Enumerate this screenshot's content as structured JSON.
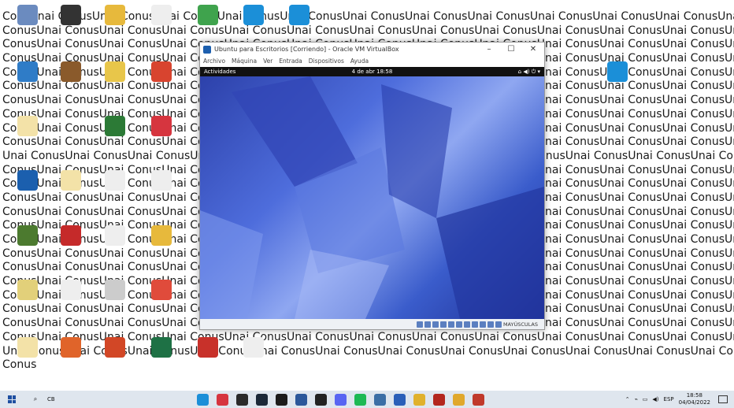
{
  "wallpaper": {
    "lines": [
      "ConsUnai ConusUnai ConusUnai ConusUnai ConusUnai ConusUnai ConusUnai ConusUnai ConusUnai ConusUnai ConusUnai ConusUnai ConusUnai",
      "ConusUnai ConusUnai ConusUnai ConusUnai ConusUnai ConusUnai ConusUnai ConusUnai ConusUnai ConusUnai ConusUnai ConusUnai ConusUnai",
      "ConusUnai ConusUnai ConusUnai ConusUnai ConusUnai ConusUnai ConusUnai ConusUnai ConusUnai ConusUnai ConusUnai ConusUnai ConusUnai",
      "ConusUnai ConusUnai ConusUnai ConusUnai ConusUnai ConusUnai ConusUnai ConusUnai ConusUnai ConusUnai ConusUnai ConusUnai ConusUnai",
      "ConusUnai ConusUnai ConusUnai ConusUnai ConusUnai ConusUnai ConusUnai ConusUnai ConusUnai ConusUnai ConusUnai ConusUnai ConusUnai",
      "ConusUnai ConusUnai ConusUnai ConusUnai ConusUnai ConusUnai ConusUnai ConusUnai ConusUnai ConusUnai ConusUnai ConusUnai ConusUnai",
      "ConusUnai ConusUnai ConusUnai ConusUnai ConusUnai ConusUnai ConusUnai ConusUnai ConusUnai ConusUnai ConusUnai ConusUnai ConusUnai",
      "ConusUnai ConusUnai ConusUnai ConusUnai ConusUnai ConusUnai ConusUnai ConusUnai ConusUnai ConusUnai ConusUnai ConusUnai ConusUnai",
      "ConusUnai ConusUnai ConusUnai ConusUnai ConusUnai ConusUnai ConusUnai ConusUnai ConusUnai ConusUnai ConusUnai ConusUnai ConusUnai",
      "ConusUnai ConusUnai ConusUnai ConusUnai ConusUnai ConusUnai ConusUnai ConusUnai ConusUnai ConusUnai ConusUnai ConusUnai ConusUnai Conus",
      "Unai ConusUnai ConusUnai ConusUnai ConusUnai ConusUnai ConusUnai ConusUnai ConusUnai ConusUnai ConusUnai ConusUnai ConusUnai",
      "ConusUnai ConusUnai ConusUnai ConusUnai ConusUnai ConusUnai ConusUnai ConusUnai ConusUnai ConusUnai ConusUnai ConusUnai ConusUnai",
      "ConusUnai ConusUnai ConusUnai ConusUnai ConusUnai ConusUnai ConusUnai ConusUnai ConusUnai ConusUnai ConusUnai ConusUnai ConusUnai",
      "ConusUnai ConusUnai ConusUnai ConusUnai ConusUnai ConusUnai ConusUnai ConusUnai ConusUnai ConusUnai ConusUnai ConusUnai ConusUnai",
      "ConusUnai ConusUnai ConusUnai ConusUnai ConusUnai ConusUnai ConusUnai ConusUnai ConusUnai ConusUnai ConusUnai ConusUnai ConusUnai",
      "ConusUnai ConusUnai ConusUnai ConusUnai ConusUnai ConusUnai ConusUnai ConusUnai ConusUnai ConusUnai ConusUnai ConusUnai ConusUnai",
      "ConusUnai ConusUnai ConusUnai ConusUnai ConusUnai ConusUnai ConusUnai ConusUnai ConusUnai ConusUnai ConusUnai ConusUnai ConusUnai",
      "ConusUnai ConusUnai ConusUnai ConusUnai ConusUnai ConusUnai ConusUnai ConusUnai ConusUnai ConusUnai ConusUnai ConusUnai ConusUnai",
      "ConusUnai ConusUnai ConusUnai ConusUnai ConusUnai ConusUnai ConusUnai ConusUnai ConusUnai ConusUnai ConusUnai ConusUnai ConusUnai",
      "ConusUnai ConusUnai ConusUnai ConusUnai ConusUnai ConusUnai ConusUnai ConusUnai ConusUnai ConusUnai ConusUnai ConusUnai ConusUnai",
      "ConusUnai ConusUnai ConusUnai ConusUnai ConusUnai ConusUnai ConusUnai ConusUnai ConusUnai ConusUnai ConusUnai ConusUnai ConusUnai",
      "ConusUnai ConusUnai ConusUnai ConusUnai ConusUnai ConusUnai ConusUnai ConusUnai ConusUnai ConusUnai ConusUnai ConusUnai ConusUnai",
      "ConusUnai ConusUnai ConusUnai ConusUnai ConusUnai ConusUnai ConusUnai ConusUnai ConusUnai ConusUnai ConusUnai ConusUnai ConusUnai",
      "ConusUnai ConusUnai ConusUnai ConusUnai ConusUnai ConusUnai ConusUnai ConusUnai ConusUnai ConusUnai ConusUnai ConusUnai ConusUnai Conus",
      "Unai ConusUnai ConusUnai ConusUnai ConusUnai ConusUnai ConusUnai ConusUnai ConusUnai ConusUnai ConusUnai ConusUnai ConusUnai ConusUnai",
      "Conus"
    ]
  },
  "desktop_icons": [
    {
      "name": "recycle-bin-icon",
      "color": "#6b8bbf"
    },
    {
      "name": "phone-icon",
      "color": "#333333"
    },
    {
      "name": "folder-icon",
      "color": "#e7b93c"
    },
    {
      "name": "file-icon",
      "color": "#eeeeee"
    },
    {
      "name": "bluestacks-icon",
      "color": "#3fa34d"
    },
    {
      "name": "edge-icon",
      "color": "#1b8fd8"
    },
    {
      "name": "edge-icon",
      "color": "#1b8fd8"
    },
    {
      "name": "app-icon",
      "color": "#2f7cc7"
    },
    {
      "name": "book-icon",
      "color": "#8a5a2b"
    },
    {
      "name": "calendar-icon",
      "color": "#e8c64a"
    },
    {
      "name": "pdf-icon",
      "color": "#d8442f"
    },
    {
      "name": "edge-icon",
      "color": "#1b8fd8"
    },
    {
      "name": "file-icon",
      "color": "#f3e2a8"
    },
    {
      "name": "search-app-icon",
      "color": "#2c7a36"
    },
    {
      "name": "opera-icon",
      "color": "#d6353f"
    },
    {
      "name": "virtualbox-icon",
      "color": "#1b5fae"
    },
    {
      "name": "file-icon",
      "color": "#f3e2a8"
    },
    {
      "name": "file-icon",
      "color": "#eeeeee"
    },
    {
      "name": "file-icon",
      "color": "#eeeeee"
    },
    {
      "name": "minecraft-icon",
      "color": "#4c7a2f"
    },
    {
      "name": "document-icon",
      "color": "#c52a2a"
    },
    {
      "name": "file-icon",
      "color": "#eeeeee"
    },
    {
      "name": "folder-icon",
      "color": "#e7b93c"
    },
    {
      "name": "file-icon",
      "color": "#e2d07a"
    },
    {
      "name": "file-icon",
      "color": "#eeeeee"
    },
    {
      "name": "app-icon",
      "color": "#cccccc"
    },
    {
      "name": "apps-icon",
      "color": "#e04b3b"
    },
    {
      "name": "file-icon",
      "color": "#f3e2a8"
    },
    {
      "name": "firefox-icon",
      "color": "#e0642a"
    },
    {
      "name": "powerpoint-icon",
      "color": "#d24726"
    },
    {
      "name": "excel-icon",
      "color": "#1e7145"
    },
    {
      "name": "app-icon",
      "color": "#c8312a"
    },
    {
      "name": "file-icon",
      "color": "#eeeeee"
    }
  ],
  "vbox": {
    "title": "Ubuntu para Escritorios [Corriendo] - Oracle VM VirtualBox",
    "menu": [
      "Archivo",
      "Máquina",
      "Ver",
      "Entrada",
      "Dispositivos",
      "Ayuda"
    ],
    "gnome": {
      "activities": "Actividades",
      "clock": "4 de abr  18:58"
    },
    "status_label": "MAYÚSCULAS"
  },
  "taskbar": {
    "cb_label": "CB",
    "apps": [
      {
        "name": "edge-icon",
        "color": "#1b8fd8"
      },
      {
        "name": "opera-icon",
        "color": "#d6353f"
      },
      {
        "name": "app-icon",
        "color": "#2a2a2a"
      },
      {
        "name": "steam-icon",
        "color": "#1b2838"
      },
      {
        "name": "app-icon",
        "color": "#1b1b1b"
      },
      {
        "name": "word-icon",
        "color": "#2b579a"
      },
      {
        "name": "epic-games-icon",
        "color": "#222222"
      },
      {
        "name": "discord-icon",
        "color": "#5865f2"
      },
      {
        "name": "spotify-icon",
        "color": "#1db954"
      },
      {
        "name": "app-icon",
        "color": "#3b6ea5"
      },
      {
        "name": "app-icon",
        "color": "#2a5fb8"
      },
      {
        "name": "chrome-icon",
        "color": "#e0b12c"
      },
      {
        "name": "app-icon",
        "color": "#b3261e"
      },
      {
        "name": "app-icon",
        "color": "#e0a82c"
      },
      {
        "name": "app-icon",
        "color": "#c0392b"
      }
    ],
    "language": "ESP",
    "time": "18:58",
    "date": "04/04/2022"
  }
}
